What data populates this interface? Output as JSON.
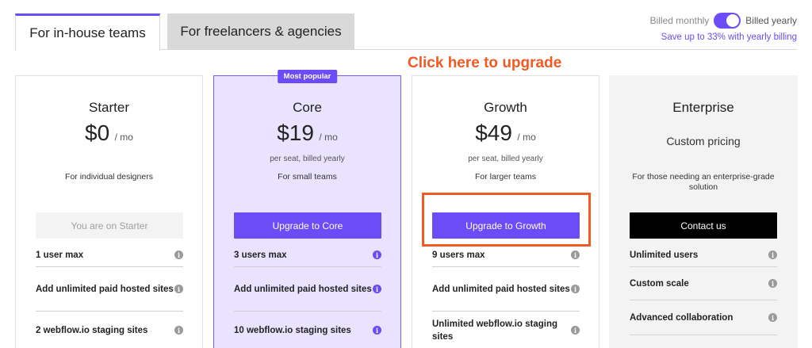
{
  "tabs": {
    "inhouse": "For in-house teams",
    "freelance": "For freelancers & agencies"
  },
  "billing": {
    "monthly_label": "Billed monthly",
    "yearly_label": "Billed yearly",
    "yearly_selected": true,
    "save_note": "Save up to 33% with yearly billing"
  },
  "annotation": {
    "text": "Click here to upgrade",
    "color": "#f15a22"
  },
  "colors": {
    "accent": "#6b4cf6",
    "annotation": "#f15a22",
    "popular_bg": "#e9e3ff"
  },
  "plans": [
    {
      "name": "Starter",
      "price": "$0",
      "per": "/ mo",
      "billing_note": "",
      "for_text": "For individual designers",
      "cta": "You are on Starter",
      "features": [
        "1 user max",
        "Add unlimited paid hosted sites",
        "2 webflow.io staging sites"
      ]
    },
    {
      "name": "Core",
      "badge": "Most popular",
      "price": "$19",
      "per": "/ mo",
      "billing_note": "per seat, billed yearly",
      "for_text": "For small teams",
      "cta": "Upgrade to Core",
      "features": [
        "3 users max",
        "Add unlimited paid hosted sites",
        "10 webflow.io staging sites"
      ]
    },
    {
      "name": "Growth",
      "price": "$49",
      "per": "/ mo",
      "billing_note": "per seat, billed yearly",
      "for_text": "For larger teams",
      "cta": "Upgrade to Growth",
      "features": [
        "9 users max",
        "Add unlimited paid hosted sites",
        "Unlimited webflow.io staging sites"
      ]
    },
    {
      "name": "Enterprise",
      "custom_pricing": "Custom pricing",
      "for_text": "For those needing an enterprise-grade solution",
      "cta": "Contact us",
      "features": [
        "Unlimited users",
        "Custom scale",
        "Advanced collaboration"
      ]
    }
  ],
  "info_icon_glyph": "i"
}
